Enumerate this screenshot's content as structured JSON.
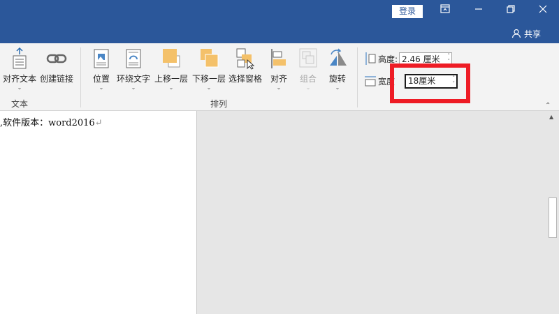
{
  "titlebar": {
    "login_label": "登录",
    "share_label": "共享",
    "colors": {
      "bar": "#2b579a"
    }
  },
  "ribbon": {
    "text_group": {
      "label": "文本",
      "buttons": [
        {
          "label": "对齐文本",
          "icon": "align-text-icon",
          "has_caret": true
        },
        {
          "label": "创建链接",
          "icon": "link-icon",
          "has_caret": false
        }
      ]
    },
    "arrange_group": {
      "label": "排列",
      "buttons": [
        {
          "label": "位置",
          "icon": "position-icon"
        },
        {
          "label": "环绕文字",
          "icon": "wrap-text-icon"
        },
        {
          "label": "上移一层",
          "icon": "bring-forward-icon"
        },
        {
          "label": "下移一层",
          "icon": "send-backward-icon"
        },
        {
          "label": "选择窗格",
          "icon": "selection-pane-icon"
        },
        {
          "label": "对齐",
          "icon": "align-icon"
        },
        {
          "label": "组合",
          "icon": "group-icon",
          "disabled": true
        },
        {
          "label": "旋转",
          "icon": "rotate-icon"
        }
      ]
    },
    "size_group": {
      "height_label": "高度:",
      "height_value": "2.46 厘米",
      "width_label": "宽度",
      "width_value": "18厘米"
    }
  },
  "document": {
    "text": ",软件版本：word2016",
    "pilcrow": "↵"
  },
  "highlight_color": "#ee1c25"
}
